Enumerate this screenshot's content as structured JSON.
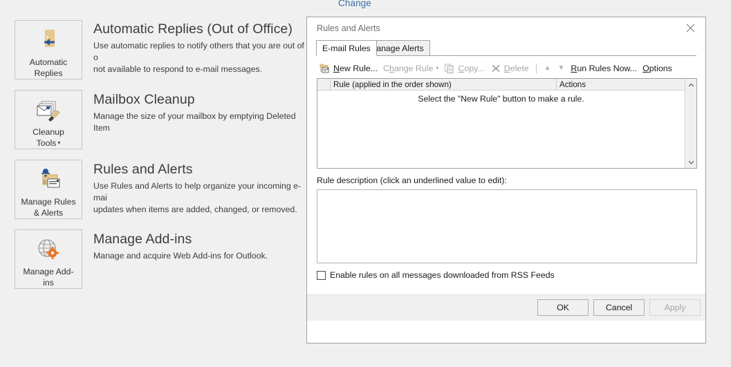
{
  "backdrop": {
    "change_link": "Change",
    "commands": [
      {
        "key": "automatic-replies",
        "label": "Automatic\nReplies",
        "icon": "door-back-arrow-icon",
        "has_caret": false
      },
      {
        "key": "cleanup-tools",
        "label": "Cleanup\nTools",
        "icon": "mailbox-cleanup-broom-icon",
        "has_caret": true
      },
      {
        "key": "manage-rules-alerts",
        "label": "Manage Rules\n& Alerts",
        "icon": "rules-alerts-folder-bell-icon",
        "has_caret": false
      },
      {
        "key": "manage-add-ins",
        "label": "Manage Add-\nins",
        "icon": "globe-gear-icon",
        "has_caret": false
      }
    ],
    "sections": [
      {
        "key": "automatic-replies",
        "title": "Automatic Replies (Out of Office)",
        "desc": "Use automatic replies to notify others that you are out of o\nnot available to respond to e-mail messages."
      },
      {
        "key": "mailbox-cleanup",
        "title": "Mailbox Cleanup",
        "desc": "Manage the size of your mailbox by emptying Deleted Item"
      },
      {
        "key": "rules-and-alerts",
        "title": "Rules and Alerts",
        "desc": "Use Rules and Alerts to help organize your incoming e-mai\nupdates when items are added, changed, or removed."
      },
      {
        "key": "manage-add-ins",
        "title": "Manage Add-ins",
        "desc": "Manage and acquire Web Add-ins for Outlook."
      }
    ]
  },
  "dialog": {
    "title": "Rules and Alerts",
    "close_icon": "close-icon",
    "tabs": [
      {
        "key": "e-mail-rules",
        "label": "E-mail Rules",
        "active": true
      },
      {
        "key": "manage-alerts",
        "label": "Manage Alerts",
        "active": false
      }
    ],
    "toolbar": {
      "new_rule": {
        "label": "New Rule...",
        "accel": "N",
        "icon": "new-rule-folder-icon",
        "disabled": false
      },
      "change_rule": {
        "label": "Change Rule",
        "accel": "h",
        "caret": "▾",
        "disabled": true
      },
      "copy": {
        "label": "Copy...",
        "accel": "C",
        "icon": "copy-documents-icon",
        "disabled": true
      },
      "delete": {
        "label": "Delete",
        "accel": "D",
        "icon": "delete-x-icon",
        "disabled": true
      },
      "move_up": {
        "icon": "arrow-up-icon",
        "glyph": "▲",
        "disabled": true
      },
      "move_down": {
        "icon": "arrow-down-icon",
        "glyph": "▼",
        "disabled": true
      },
      "run_rules_now": {
        "label": "Run Rules Now...",
        "accel": "R",
        "disabled": false
      },
      "options": {
        "label": "Options",
        "accel": "O",
        "disabled": false
      }
    },
    "rules_list": {
      "columns": [
        "",
        "Rule (applied in the order shown)",
        "Actions"
      ],
      "rows": [],
      "empty_message": "Select the \"New Rule\" button to make a rule.",
      "scrollbar": {
        "up_icon": "chevron-up-icon",
        "up_glyph": "⌃",
        "down_icon": "chevron-down-icon",
        "down_glyph": "⌄"
      }
    },
    "description": {
      "label": "Rule description (click an underlined value to edit):",
      "value": ""
    },
    "rss_checkbox": {
      "label": "Enable rules on all messages downloaded from RSS Feeds",
      "checked": false
    },
    "footer_buttons": [
      {
        "key": "ok",
        "label": "OK",
        "disabled": false
      },
      {
        "key": "cancel",
        "label": "Cancel",
        "disabled": false
      },
      {
        "key": "apply",
        "label": "Apply",
        "disabled": true
      }
    ]
  },
  "colors": {
    "link_blue": "#3a6ea5",
    "dialog_bg": "#ffffff",
    "page_bg": "#f0f0f0",
    "border_grey": "#a0a0a0",
    "disabled_text": "#a6a6a6",
    "folder_tan": "#e8c88a",
    "accent_orange": "#e8762c",
    "accent_blue": "#2a5699"
  }
}
